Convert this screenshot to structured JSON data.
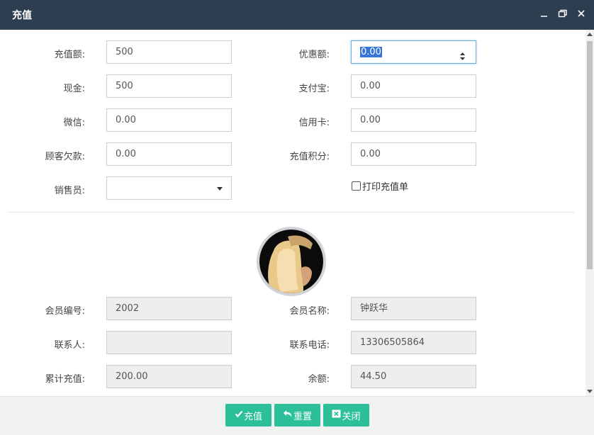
{
  "window": {
    "title": "充值",
    "icons": [
      "minimize-icon",
      "restore-icon",
      "close-icon"
    ]
  },
  "recharge": {
    "amount_label": "充值额:",
    "amount_value": "500",
    "discount_label": "优惠额:",
    "discount_value": "0.00",
    "cash_label": "现金:",
    "cash_value": "500",
    "alipay_label": "支付宝:",
    "alipay_value": "0.00",
    "wechat_label": "微信:",
    "wechat_value": "0.00",
    "credit_label": "信用卡:",
    "credit_value": "0.00",
    "debt_label": "顾客欠款:",
    "debt_value": "0.00",
    "points_label": "充值积分:",
    "points_value": "0.00",
    "seller_label": "销售员:",
    "seller_value": "",
    "print_label": "打印充值单",
    "print_checked": false
  },
  "member": {
    "number_label": "会员编号:",
    "number_value": "2002",
    "name_label": "会员名称:",
    "name_value": "钟跃华",
    "contact_label": "联系人:",
    "contact_value": "",
    "phone_label": "联系电话:",
    "phone_value": "13306505864",
    "total_label": "累计充值:",
    "total_value": "200.00",
    "balance_label": "余额:",
    "balance_value": "44.50"
  },
  "footer": {
    "recharge_label": "充值",
    "reset_label": "重置",
    "close_label": "关闭"
  },
  "colors": {
    "titlebar": "#2c3e50",
    "button": "#2bbf9a",
    "footer_bg": "#f0f2f2",
    "readonly_bg": "#eeeeee",
    "focus_border": "#66afe9"
  }
}
